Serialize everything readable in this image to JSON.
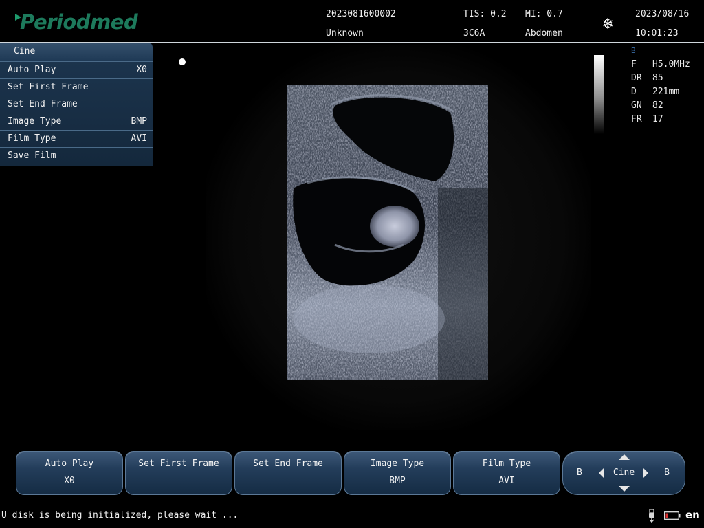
{
  "header": {
    "logo_text": "Periodmed",
    "patient_id": "2023081600002",
    "patient_name": "Unknown",
    "tis": "TIS: 0.2",
    "probe": "3C6A",
    "mi": "MI: 0.7",
    "preset": "Abdomen",
    "date": "2023/08/16",
    "time": "10:01:23",
    "freeze_icon": "snowflake-icon"
  },
  "cine_menu": {
    "title": "Cine",
    "items": [
      {
        "label": "Auto Play",
        "value": "X0"
      },
      {
        "label": "Set First Frame",
        "value": ""
      },
      {
        "label": "Set End Frame",
        "value": ""
      },
      {
        "label": "Image Type",
        "value": "BMP"
      },
      {
        "label": "Film Type",
        "value": "AVI"
      },
      {
        "label": "Save Film",
        "value": ""
      }
    ]
  },
  "params": {
    "mode": "B",
    "rows": [
      {
        "key": "F",
        "value": "H5.0MHz"
      },
      {
        "key": "DR",
        "value": "85"
      },
      {
        "key": "D",
        "value": "221mm"
      },
      {
        "key": "GN",
        "value": "82"
      },
      {
        "key": "FR",
        "value": "17"
      }
    ]
  },
  "buttons": [
    {
      "line1": "Auto Play",
      "line2": "X0"
    },
    {
      "line1": "Set First Frame",
      "line2": ""
    },
    {
      "line1": "Set End Frame",
      "line2": ""
    },
    {
      "line1": "Image Type",
      "line2": "BMP"
    },
    {
      "line1": "Film Type",
      "line2": "AVI"
    }
  ],
  "cine_pad": {
    "center": "Cine",
    "left_label": "B",
    "right_label": "B"
  },
  "status": {
    "message": "U disk is being initialized, please wait ...",
    "language": "en"
  },
  "colors": {
    "logo": "#1d7a5c",
    "panel": "#1d3650",
    "button_top": "#3d5878",
    "button_bottom": "#152c44",
    "mode_label": "#3a6ea8"
  }
}
